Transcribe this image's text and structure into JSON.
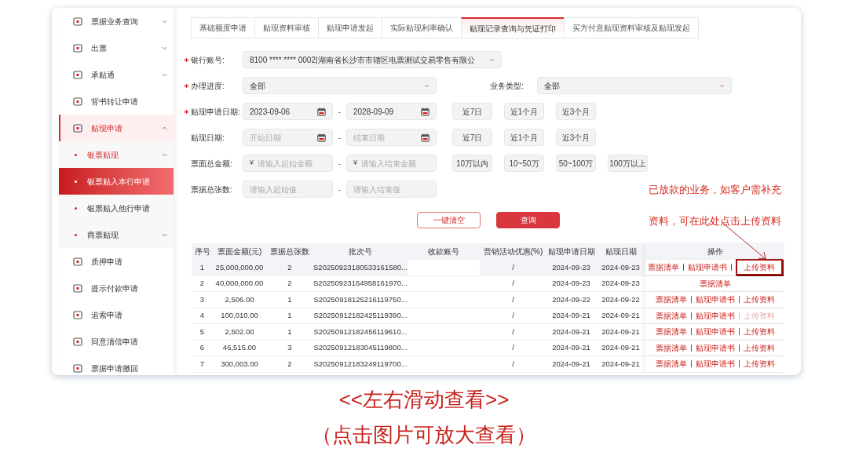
{
  "sidebar": {
    "items": [
      {
        "label": "票据业务查询",
        "expanded": false,
        "selected": false
      },
      {
        "label": "出票",
        "expanded": false,
        "selected": false
      },
      {
        "label": "承贴通",
        "expanded": false,
        "selected": false
      },
      {
        "label": "背书转让申请",
        "selected": false
      },
      {
        "label": "贴现申请",
        "expanded": true,
        "selected": false,
        "children": [
          {
            "label": "银票贴现",
            "expanded": true,
            "selected": false,
            "children": [
              {
                "label": "银票贴入本行申请",
                "selected": true
              },
              {
                "label": "银票贴入他行申请",
                "selected": false
              }
            ]
          },
          {
            "label": "商票贴现",
            "expanded": false,
            "selected": false
          }
        ]
      },
      {
        "label": "质押申请",
        "selected": false
      },
      {
        "label": "提示付款申请",
        "selected": false
      },
      {
        "label": "追索申请",
        "selected": false
      },
      {
        "label": "同意清偿申请",
        "selected": false
      },
      {
        "label": "票据申请撤回",
        "selected": false
      }
    ]
  },
  "tabs": [
    {
      "label": "基础额度申请",
      "selected": false
    },
    {
      "label": "贴现资料审核",
      "selected": false
    },
    {
      "label": "贴现申请发起",
      "selected": false
    },
    {
      "label": "实际贴现利率确认",
      "selected": false
    },
    {
      "label": "贴现记录查询与凭证打印",
      "selected": true
    },
    {
      "label": "买方付息贴现资料审核及贴现发起",
      "selected": false
    }
  ],
  "filters": [
    {
      "label": "银行账号:",
      "required": true,
      "fields": [
        {
          "kind": "select",
          "value": "8100 **** **** 0002|湖南省长沙市市辖区电票测试交易零售有限公"
        }
      ]
    },
    {
      "label": "办理进度:",
      "required": true,
      "fields": [
        {
          "kind": "select",
          "value": "全部"
        }
      ],
      "extra": {
        "label": "业务类型:",
        "field": {
          "kind": "select",
          "value": "全部"
        }
      }
    },
    {
      "label": "贴现申请日期:",
      "required": true,
      "separator": "-",
      "fields": [
        {
          "kind": "date",
          "value": "2023-09-06"
        },
        {
          "kind": "date",
          "value": "2028-09-09"
        }
      ],
      "quick": [
        "近7日",
        "近1个月",
        "近3个月"
      ]
    },
    {
      "label": "贴现日期:",
      "required": false,
      "separator": "-",
      "fields": [
        {
          "kind": "date",
          "placeholder": "开始日期"
        },
        {
          "kind": "date",
          "placeholder": "结束日期"
        }
      ],
      "quick": [
        "近7日",
        "近1个月",
        "近3个月"
      ]
    },
    {
      "label": "票面总金额:",
      "required": false,
      "separator": "-",
      "fields": [
        {
          "kind": "amount",
          "prefix": "¥",
          "placeholder": "请输入起始金额"
        },
        {
          "kind": "amount",
          "prefix": "¥",
          "placeholder": "请输入结束金额"
        }
      ],
      "quick": [
        "10万以内",
        "10~50万",
        "50~100万",
        "100万以上"
      ]
    },
    {
      "label": "票据总张数:",
      "required": false,
      "separator": "-",
      "fields": [
        {
          "kind": "text",
          "placeholder": "请输入起始值"
        },
        {
          "kind": "text",
          "placeholder": "请输入结束值"
        }
      ]
    }
  ],
  "buttons": [
    {
      "label": "一键清空",
      "kind": "secondary"
    },
    {
      "label": "查询",
      "kind": "primary"
    }
  ],
  "table": {
    "columns": [
      {
        "label": "序号"
      },
      {
        "label": "票面金额(元)"
      },
      {
        "label": "票据总张数"
      },
      {
        "label": "批次号"
      },
      {
        "label": "收款账号"
      },
      {
        "label": "营销活动优惠(%)"
      },
      {
        "label": "贴现申请日期"
      },
      {
        "label": "贴现日期"
      },
      {
        "label": "操作"
      }
    ],
    "rows": [
      {
        "hover": true,
        "cells": [
          "1",
          "25,000,000.00",
          "2",
          "S20250923180533161580...",
          "",
          "/",
          "2024-09-23",
          "2024-09-23"
        ],
        "actions": [
          {
            "label": "票据清单",
            "disabled": false,
            "highlighted": false
          },
          {
            "label": "贴现申请书",
            "disabled": false,
            "highlighted": false
          },
          {
            "label": "上传资料",
            "disabled": false,
            "highlighted": true
          }
        ]
      },
      {
        "hover": false,
        "cells": [
          "2",
          "40,000,000.00",
          "2",
          "S20250923164958161970...",
          "",
          "/",
          "2024-09-23",
          "2024-09-23"
        ],
        "actions": [
          {
            "label": "票据清单",
            "disabled": false,
            "highlighted": false
          }
        ]
      },
      {
        "hover": false,
        "cells": [
          "3",
          "2,506.00",
          "1",
          "S20250918125216119750...",
          "",
          "/",
          "2024-09-22",
          "2024-09-22"
        ],
        "actions": [
          {
            "label": "票据清单",
            "disabled": false,
            "highlighted": false
          },
          {
            "label": "贴现申请书",
            "disabled": false,
            "highlighted": false
          },
          {
            "label": "上传资料",
            "disabled": false,
            "highlighted": false
          }
        ]
      },
      {
        "hover": false,
        "cells": [
          "4",
          "100,010.00",
          "1",
          "S20250912182425119390...",
          "",
          "/",
          "2024-09-21",
          "2024-09-21"
        ],
        "actions": [
          {
            "label": "票据清单",
            "disabled": false,
            "highlighted": false
          },
          {
            "label": "贴现申请书",
            "disabled": false,
            "highlighted": false
          },
          {
            "label": "上传资料",
            "disabled": true,
            "highlighted": false
          }
        ]
      },
      {
        "hover": false,
        "cells": [
          "5",
          "2,502.00",
          "1",
          "S20250912182456119610...",
          "",
          "/",
          "2024-09-21",
          "2024-09-21"
        ],
        "actions": [
          {
            "label": "票据清单",
            "disabled": false,
            "highlighted": false
          },
          {
            "label": "贴现申请书",
            "disabled": false,
            "highlighted": false
          },
          {
            "label": "上传资料",
            "disabled": false,
            "highlighted": false
          }
        ]
      },
      {
        "hover": false,
        "cells": [
          "6",
          "46,515.00",
          "3",
          "S20250912183045119800...",
          "",
          "/",
          "2024-09-21",
          "2024-09-21"
        ],
        "actions": [
          {
            "label": "票据清单",
            "disabled": false,
            "highlighted": false
          },
          {
            "label": "贴现申请书",
            "disabled": false,
            "highlighted": false
          },
          {
            "label": "上传资料",
            "disabled": false,
            "highlighted": false
          }
        ]
      },
      {
        "hover": false,
        "cells": [
          "7",
          "300,003.00",
          "2",
          "S20250912183249119700...",
          "",
          "/",
          "2024-09-21",
          "2024-09-21"
        ],
        "actions": [
          {
            "label": "票据清单",
            "disabled": false,
            "highlighted": false
          },
          {
            "label": "贴现申请书",
            "disabled": false,
            "highlighted": false
          },
          {
            "label": "上传资料",
            "disabled": false,
            "highlighted": false
          }
        ]
      }
    ]
  },
  "annotation": "已放款的业务，如客户需补充资料，可在此处点击上传资料",
  "caption": [
    "<<左右滑动查看>>",
    "（点击图片可放大查看）"
  ]
}
